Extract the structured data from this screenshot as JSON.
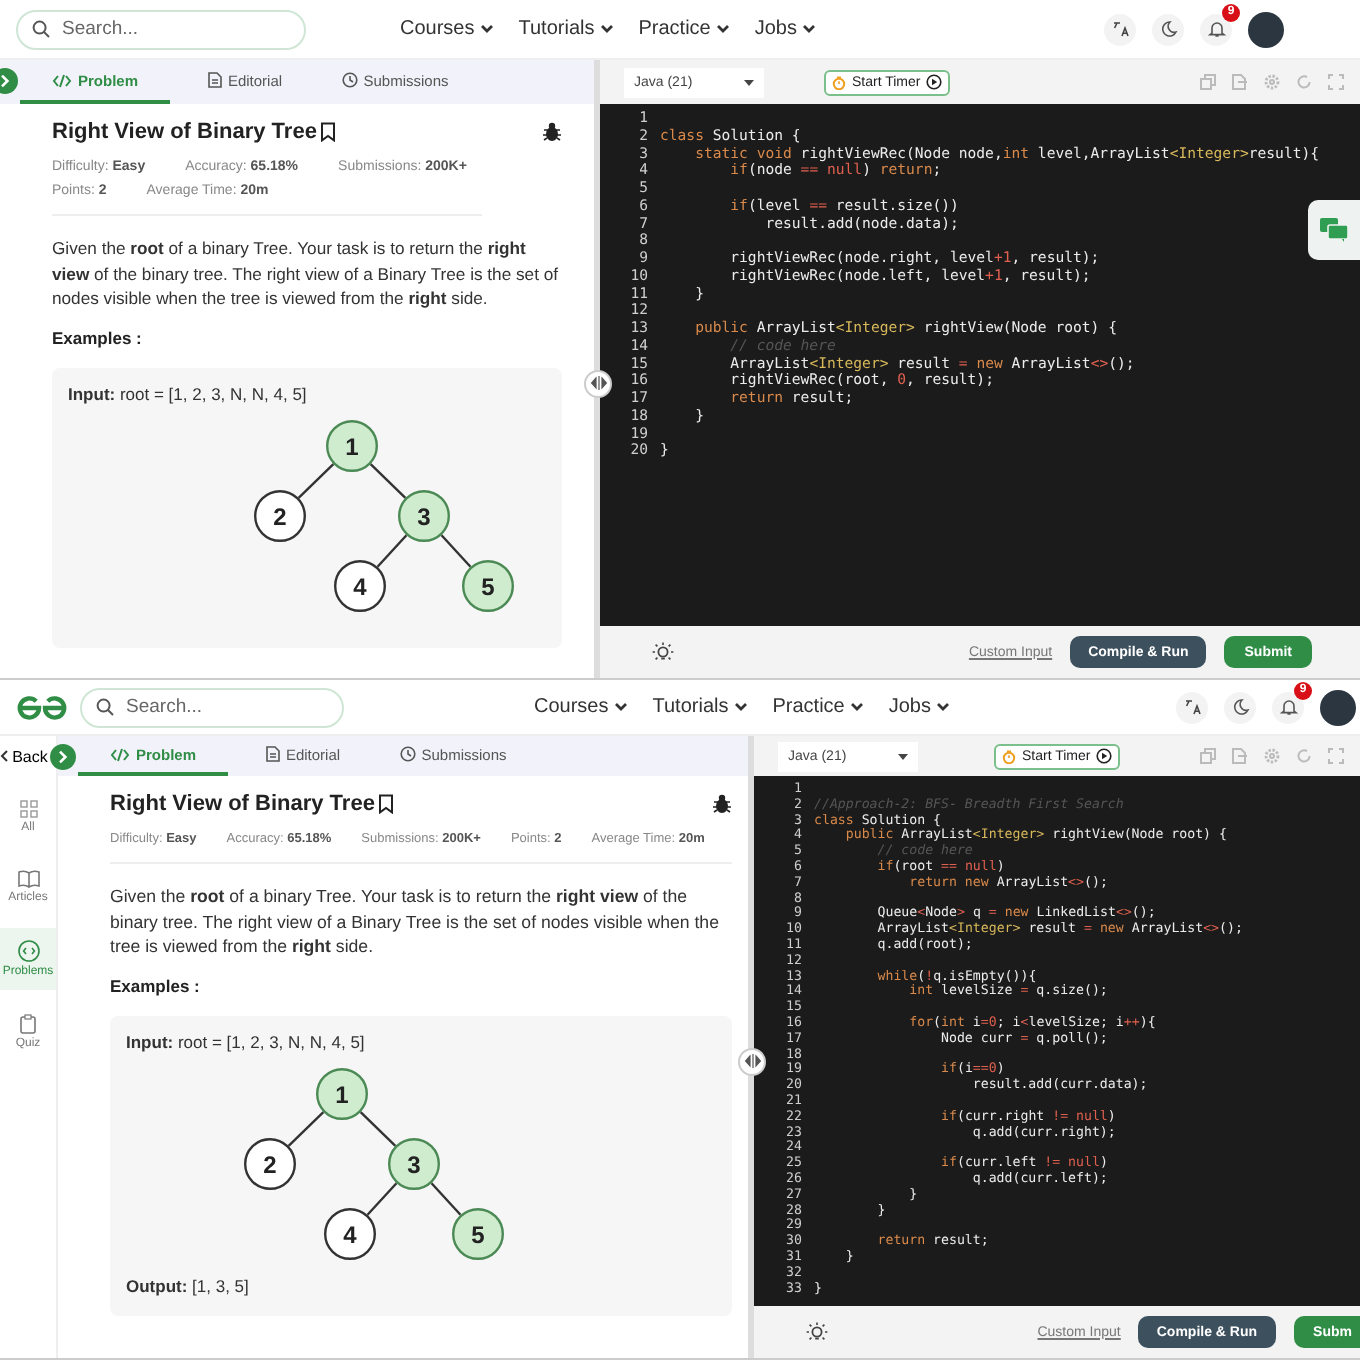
{
  "screens": [
    {
      "chat_widget": true,
      "nav": {
        "search": {
          "placeholder": "Search..."
        },
        "menus": [
          "Courses",
          "Tutorials",
          "Practice",
          "Jobs"
        ],
        "notifications": "9"
      },
      "tabs": [
        {
          "label": "Problem",
          "selected": true
        },
        {
          "label": "Editorial",
          "selected": false
        },
        {
          "label": "Submissions",
          "selected": false
        }
      ],
      "problem": {
        "title": "Right View of Binary Tree",
        "meta": [
          {
            "label": "Difficulty:",
            "value": "Easy"
          },
          {
            "label": "Accuracy:",
            "value": "65.18%"
          },
          {
            "label": "Submissions:",
            "value": "200K+"
          },
          {
            "label": "Points:",
            "value": "2"
          },
          {
            "label": "Average Time:",
            "value": "20m"
          }
        ],
        "description": "Given the **root** of a binary Tree. Your task is to return the **right view** of the binary tree. The right view of a Binary Tree is the set of nodes visible when the tree is viewed from the **right** side.",
        "examples_heading": "Examples :",
        "example": {
          "input": "**Input:**  root = [1, 2, 3, N, N, 4, 5]",
          "tree": {
            "label": "1",
            "highlighted": true,
            "children": [
              {
                "label": "2",
                "highlighted": false
              },
              {
                "label": "3",
                "highlighted": true,
                "children": [
                  {
                    "label": "4",
                    "highlighted": false
                  },
                  {
                    "label": "5",
                    "highlighted": true
                  }
                ]
              }
            ]
          }
        }
      },
      "editor": {
        "language": "Java (21)",
        "timer": "Start Timer",
        "custom_input": "Custom Input",
        "compile": "Compile & Run",
        "submit": "Submit",
        "lines": [
          {
            "n": "1"
          },
          {
            "n": "2",
            "code": [
              {
                "kind": "keyword",
                "text": "class"
              },
              {
                "kind": "plain",
                "text": " Solution {"
              }
            ]
          },
          {
            "n": "3",
            "code": [
              {
                "kind": "keyword",
                "text": "    static void"
              },
              {
                "kind": "plain",
                "text": " rightViewRec(Node node,"
              },
              {
                "kind": "keyword",
                "text": "int"
              },
              {
                "kind": "plain",
                "text": " level,ArrayList"
              },
              {
                "kind": "type",
                "text": "<Integer>"
              },
              {
                "kind": "plain",
                "text": "result){"
              }
            ]
          },
          {
            "n": "4",
            "code": [
              {
                "kind": "keyword",
                "text": "        if"
              },
              {
                "kind": "plain",
                "text": "(node "
              },
              {
                "kind": "operator",
                "text": "== null"
              },
              {
                "kind": "plain",
                "text": ") "
              },
              {
                "kind": "keyword",
                "text": "return"
              },
              {
                "kind": "plain",
                "text": ";"
              }
            ]
          },
          {
            "n": "5"
          },
          {
            "n": "6",
            "code": [
              {
                "kind": "keyword",
                "text": "        if"
              },
              {
                "kind": "plain",
                "text": "(level "
              },
              {
                "kind": "operator",
                "text": "=="
              },
              {
                "kind": "plain",
                "text": " result.size())"
              }
            ]
          },
          {
            "n": "7",
            "code": [
              {
                "kind": "plain",
                "text": "            result.add(node.data);"
              }
            ]
          },
          {
            "n": "8"
          },
          {
            "n": "9",
            "code": [
              {
                "kind": "plain",
                "text": "        rightViewRec(node.right, level"
              },
              {
                "kind": "operator",
                "text": "+1"
              },
              {
                "kind": "plain",
                "text": ", result);"
              }
            ]
          },
          {
            "n": "10",
            "code": [
              {
                "kind": "plain",
                "text": "        rightViewRec(node.left, level"
              },
              {
                "kind": "operator",
                "text": "+1"
              },
              {
                "kind": "plain",
                "text": ", result);"
              }
            ]
          },
          {
            "n": "11",
            "code": [
              {
                "kind": "plain",
                "text": "    }"
              }
            ]
          },
          {
            "n": "12"
          },
          {
            "n": "13",
            "code": [
              {
                "kind": "keyword",
                "text": "    public"
              },
              {
                "kind": "plain",
                "text": " ArrayList"
              },
              {
                "kind": "type",
                "text": "<Integer>"
              },
              {
                "kind": "plain",
                "text": " rightView(Node root) {"
              }
            ]
          },
          {
            "n": "14",
            "code": [
              {
                "kind": "comment",
                "text": "        // code here"
              }
            ]
          },
          {
            "n": "15",
            "code": [
              {
                "kind": "plain",
                "text": "        ArrayList"
              },
              {
                "kind": "type",
                "text": "<Integer>"
              },
              {
                "kind": "plain",
                "text": " result "
              },
              {
                "kind": "operator",
                "text": "="
              },
              {
                "kind": "keyword",
                "text": " new"
              },
              {
                "kind": "plain",
                "text": " ArrayList"
              },
              {
                "kind": "operator",
                "text": "<>"
              },
              {
                "kind": "plain",
                "text": "();"
              }
            ]
          },
          {
            "n": "16",
            "code": [
              {
                "kind": "plain",
                "text": "        rightViewRec(root, "
              },
              {
                "kind": "operator",
                "text": "0"
              },
              {
                "kind": "plain",
                "text": ", result);"
              }
            ]
          },
          {
            "n": "17",
            "code": [
              {
                "kind": "keyword",
                "text": "        return"
              },
              {
                "kind": "plain",
                "text": " result;"
              }
            ]
          },
          {
            "n": "18",
            "code": [
              {
                "kind": "plain",
                "text": "    }"
              }
            ]
          },
          {
            "n": "19"
          },
          {
            "n": "20",
            "code": [
              {
                "kind": "plain",
                "text": "}"
              }
            ]
          }
        ]
      }
    },
    {
      "logo": true,
      "nav": {
        "search": {
          "placeholder": "Search..."
        },
        "menus": [
          "Courses",
          "Tutorials",
          "Practice",
          "Jobs"
        ],
        "notifications": "9"
      },
      "back": "Back",
      "sidebar": [
        {
          "label": "All",
          "selected": false
        },
        {
          "label": "Articles",
          "selected": false
        },
        {
          "label": "Problems",
          "selected": true
        },
        {
          "label": "Quiz",
          "selected": false
        }
      ],
      "tabs": [
        {
          "label": "Problem",
          "selected": true
        },
        {
          "label": "Editorial",
          "selected": false
        },
        {
          "label": "Submissions",
          "selected": false
        }
      ],
      "problem": {
        "title": "Right View of Binary Tree",
        "meta": [
          {
            "label": "Difficulty:",
            "value": "Easy"
          },
          {
            "label": "Accuracy:",
            "value": "65.18%"
          },
          {
            "label": "Submissions:",
            "value": "200K+"
          },
          {
            "label": "Points:",
            "value": "2"
          },
          {
            "label": "Average Time:",
            "value": "20m"
          }
        ],
        "description": "Given the **root** of a binary Tree. Your task is to return the **right view** of the binary tree. The right view of a Binary Tree is the set of nodes visible when the tree is viewed from the **right** side.",
        "examples_heading": "Examples :",
        "example": {
          "input": "**Input:**  root = [1, 2, 3, N, N, 4, 5]",
          "tree": {
            "label": "1",
            "highlighted": true,
            "children": [
              {
                "label": "2",
                "highlighted": false
              },
              {
                "label": "3",
                "highlighted": true,
                "children": [
                  {
                    "label": "4",
                    "highlighted": false
                  },
                  {
                    "label": "5",
                    "highlighted": true
                  }
                ]
              }
            ]
          },
          "output": "**Output:**  [1, 3, 5]"
        }
      },
      "editor": {
        "language": "Java (21)",
        "timer": "Start Timer",
        "custom_input": "Custom Input",
        "compile": "Compile & Run",
        "submit": "Subm",
        "lines": [
          {
            "n": "1"
          },
          {
            "n": "2",
            "code": [
              {
                "kind": "comment",
                "text": "//Approach-2: BFS- Breadth First Search"
              }
            ]
          },
          {
            "n": "3",
            "code": [
              {
                "kind": "keyword",
                "text": "class"
              },
              {
                "kind": "plain",
                "text": " Solution {"
              }
            ]
          },
          {
            "n": "4",
            "code": [
              {
                "kind": "keyword",
                "text": "    public"
              },
              {
                "kind": "plain",
                "text": " ArrayList"
              },
              {
                "kind": "type",
                "text": "<Integer>"
              },
              {
                "kind": "plain",
                "text": " rightView(Node root) {"
              }
            ]
          },
          {
            "n": "5",
            "code": [
              {
                "kind": "comment",
                "text": "        // code here"
              }
            ]
          },
          {
            "n": "6",
            "code": [
              {
                "kind": "keyword",
                "text": "        if"
              },
              {
                "kind": "plain",
                "text": "(root "
              },
              {
                "kind": "operator",
                "text": "== null"
              },
              {
                "kind": "plain",
                "text": ")"
              }
            ]
          },
          {
            "n": "7",
            "code": [
              {
                "kind": "keyword",
                "text": "            return new"
              },
              {
                "kind": "plain",
                "text": " ArrayList"
              },
              {
                "kind": "operator",
                "text": "<>"
              },
              {
                "kind": "plain",
                "text": "();"
              }
            ]
          },
          {
            "n": "8"
          },
          {
            "n": "9",
            "code": [
              {
                "kind": "plain",
                "text": "        Queue"
              },
              {
                "kind": "operator",
                "text": "<"
              },
              {
                "kind": "plain",
                "text": "Node"
              },
              {
                "kind": "operator",
                "text": ">"
              },
              {
                "kind": "plain",
                "text": " q "
              },
              {
                "kind": "operator",
                "text": "="
              },
              {
                "kind": "keyword",
                "text": " new"
              },
              {
                "kind": "plain",
                "text": " LinkedList"
              },
              {
                "kind": "operator",
                "text": "<>"
              },
              {
                "kind": "plain",
                "text": "();"
              }
            ]
          },
          {
            "n": "10",
            "code": [
              {
                "kind": "plain",
                "text": "        ArrayList"
              },
              {
                "kind": "type",
                "text": "<Integer>"
              },
              {
                "kind": "plain",
                "text": " result "
              },
              {
                "kind": "operator",
                "text": "="
              },
              {
                "kind": "keyword",
                "text": " new"
              },
              {
                "kind": "plain",
                "text": " ArrayList"
              },
              {
                "kind": "operator",
                "text": "<>"
              },
              {
                "kind": "plain",
                "text": "();"
              }
            ]
          },
          {
            "n": "11",
            "code": [
              {
                "kind": "plain",
                "text": "        q.add(root);"
              }
            ]
          },
          {
            "n": "12"
          },
          {
            "n": "13",
            "code": [
              {
                "kind": "keyword",
                "text": "        while"
              },
              {
                "kind": "plain",
                "text": "("
              },
              {
                "kind": "operator",
                "text": "!"
              },
              {
                "kind": "plain",
                "text": "q.isEmpty()){"
              }
            ]
          },
          {
            "n": "14",
            "code": [
              {
                "kind": "keyword",
                "text": "            int"
              },
              {
                "kind": "plain",
                "text": " levelSize "
              },
              {
                "kind": "operator",
                "text": "="
              },
              {
                "kind": "plain",
                "text": " q.size();"
              }
            ]
          },
          {
            "n": "15"
          },
          {
            "n": "16",
            "code": [
              {
                "kind": "keyword",
                "text": "            for"
              },
              {
                "kind": "plain",
                "text": "("
              },
              {
                "kind": "keyword",
                "text": "int"
              },
              {
                "kind": "plain",
                "text": " i"
              },
              {
                "kind": "operator",
                "text": "=0"
              },
              {
                "kind": "plain",
                "text": "; i"
              },
              {
                "kind": "operator",
                "text": "<"
              },
              {
                "kind": "plain",
                "text": "levelSize; i"
              },
              {
                "kind": "operator",
                "text": "++"
              },
              {
                "kind": "plain",
                "text": "){"
              }
            ]
          },
          {
            "n": "17",
            "code": [
              {
                "kind": "plain",
                "text": "                Node curr "
              },
              {
                "kind": "operator",
                "text": "="
              },
              {
                "kind": "plain",
                "text": " q.poll();"
              }
            ]
          },
          {
            "n": "18"
          },
          {
            "n": "19",
            "code": [
              {
                "kind": "keyword",
                "text": "                if"
              },
              {
                "kind": "plain",
                "text": "(i"
              },
              {
                "kind": "operator",
                "text": "==0"
              },
              {
                "kind": "plain",
                "text": ")"
              }
            ]
          },
          {
            "n": "20",
            "code": [
              {
                "kind": "plain",
                "text": "                    result.add(curr.data);"
              }
            ]
          },
          {
            "n": "21"
          },
          {
            "n": "22",
            "code": [
              {
                "kind": "keyword",
                "text": "                if"
              },
              {
                "kind": "plain",
                "text": "(curr.right "
              },
              {
                "kind": "operator",
                "text": "!= null"
              },
              {
                "kind": "plain",
                "text": ")"
              }
            ]
          },
          {
            "n": "23",
            "code": [
              {
                "kind": "plain",
                "text": "                    q.add(curr.right);"
              }
            ]
          },
          {
            "n": "24"
          },
          {
            "n": "25",
            "code": [
              {
                "kind": "keyword",
                "text": "                if"
              },
              {
                "kind": "plain",
                "text": "(curr.left "
              },
              {
                "kind": "operator",
                "text": "!= null"
              },
              {
                "kind": "plain",
                "text": ")"
              }
            ]
          },
          {
            "n": "26",
            "code": [
              {
                "kind": "plain",
                "text": "                    q.add(curr.left);"
              }
            ]
          },
          {
            "n": "27",
            "code": [
              {
                "kind": "plain",
                "text": "            }"
              }
            ]
          },
          {
            "n": "28",
            "code": [
              {
                "kind": "plain",
                "text": "        }"
              }
            ]
          },
          {
            "n": "29"
          },
          {
            "n": "30",
            "code": [
              {
                "kind": "keyword",
                "text": "        return"
              },
              {
                "kind": "plain",
                "text": " result;"
              }
            ]
          },
          {
            "n": "31",
            "code": [
              {
                "kind": "plain",
                "text": "    }"
              }
            ]
          },
          {
            "n": "32"
          },
          {
            "n": "33",
            "code": [
              {
                "kind": "plain",
                "text": "}"
              }
            ]
          }
        ]
      }
    }
  ]
}
